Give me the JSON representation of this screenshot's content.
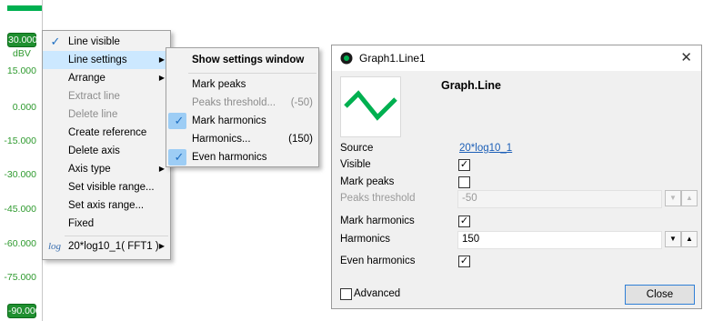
{
  "axis": {
    "unit": "dBV",
    "ticks": [
      "30.000",
      "15.000",
      "0.000",
      "-15.000",
      "-30.000",
      "-45.000",
      "-60.000",
      "-75.000",
      "-90.000"
    ],
    "color": "#2e9a2e"
  },
  "context_menu": {
    "items": [
      {
        "label": "Line visible",
        "checked": true
      },
      {
        "label": "Line settings",
        "submenu": true,
        "highlighted": true
      },
      {
        "label": "Arrange",
        "submenu": true
      },
      {
        "label": "Extract line",
        "disabled": true
      },
      {
        "label": "Delete line",
        "disabled": true
      },
      {
        "label": "Create reference"
      },
      {
        "label": "Delete axis"
      },
      {
        "label": "Axis type",
        "submenu": true
      },
      {
        "label": "Set visible range..."
      },
      {
        "label": "Set axis range..."
      },
      {
        "label": "Fixed"
      },
      {
        "label": "20*log10_1( FFT1 )",
        "prefix": "log",
        "submenu": true
      }
    ]
  },
  "line_settings_menu": {
    "header": "Show settings window",
    "items": [
      {
        "label": "Mark peaks"
      },
      {
        "label": "Peaks threshold...",
        "value": "(-50)",
        "disabled": true
      },
      {
        "label": "Mark harmonics",
        "checked": true
      },
      {
        "label": "Harmonics...",
        "value": "(150)"
      },
      {
        "label": "Even harmonics",
        "checked": true
      }
    ]
  },
  "dialog": {
    "title": "Graph1.Line1",
    "graph_name": "Graph.Line",
    "source_label": "Source",
    "source_value": "20*log10_1",
    "visible_label": "Visible",
    "visible_checked": true,
    "mark_peaks_label": "Mark peaks",
    "mark_peaks_checked": false,
    "peaks_threshold_label": "Peaks threshold",
    "peaks_threshold_value": "-50",
    "mark_harmonics_label": "Mark harmonics",
    "mark_harmonics_checked": true,
    "harmonics_label": "Harmonics",
    "harmonics_value": "150",
    "even_harmonics_label": "Even harmonics",
    "even_harmonics_checked": true,
    "advanced_label": "Advanced",
    "advanced_checked": false,
    "close_label": "Close",
    "accent": "#00b050"
  }
}
